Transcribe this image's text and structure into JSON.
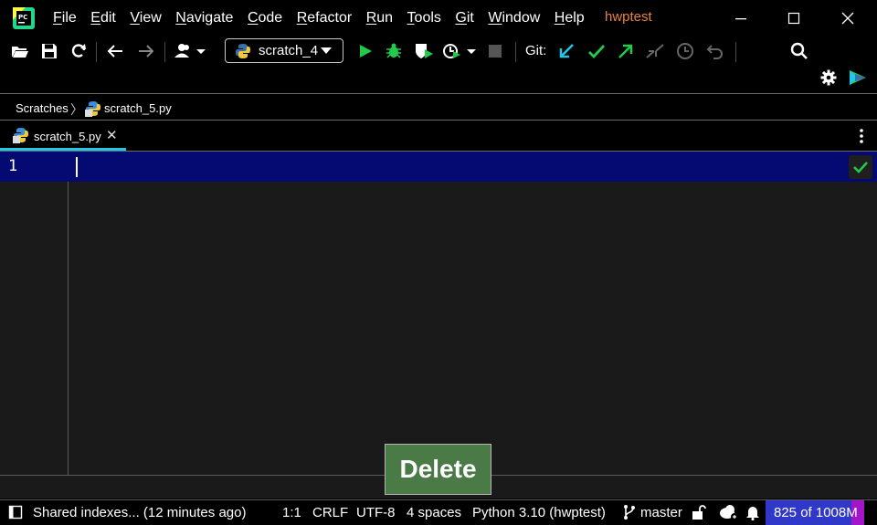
{
  "menu": {
    "file": {
      "mnemonic": "F",
      "rest": "ile"
    },
    "edit": {
      "mnemonic": "E",
      "rest": "dit"
    },
    "view": {
      "mnemonic": "V",
      "rest": "iew"
    },
    "navigate": {
      "mnemonic": "N",
      "rest": "avigate"
    },
    "code": {
      "mnemonic": "C",
      "rest": "ode"
    },
    "refactor": {
      "mnemonic": "R",
      "rest": "efactor"
    },
    "run": {
      "mnemonic": "R",
      "rest": "un"
    },
    "tools": {
      "mnemonic": "T",
      "rest": "ools"
    },
    "git": {
      "mnemonic": "G",
      "rest": "it"
    },
    "window": {
      "mnemonic": "W",
      "rest": "indow"
    },
    "help": {
      "mnemonic": "H",
      "rest": "elp"
    }
  },
  "project_title": "hwptest",
  "toolbar": {
    "run_config": "scratch_4",
    "git_label": "Git:"
  },
  "breadcrumbs": {
    "root": "Scratches",
    "file": "scratch_5.py"
  },
  "tab": {
    "label": "scratch_5.py"
  },
  "editor": {
    "line_number": "1"
  },
  "overlay": {
    "delete_label": "Delete"
  },
  "statusbar": {
    "indexes": "Shared indexes... (12 minutes ago)",
    "position": "1:1",
    "line_sep": "CRLF",
    "encoding": "UTF-8",
    "indent": "4 spaces",
    "interpreter": "Python 3.10 (hwptest)",
    "branch": "master",
    "memory": "825 of 1008M"
  },
  "colors": {
    "accent_tab": "#1ec8e6",
    "current_line": "#050a73",
    "title_orange": "#e8823c",
    "run_green": "#22c94a",
    "git_update_blue": "#1ec8e6",
    "memory_bar": "#2f38c9"
  }
}
